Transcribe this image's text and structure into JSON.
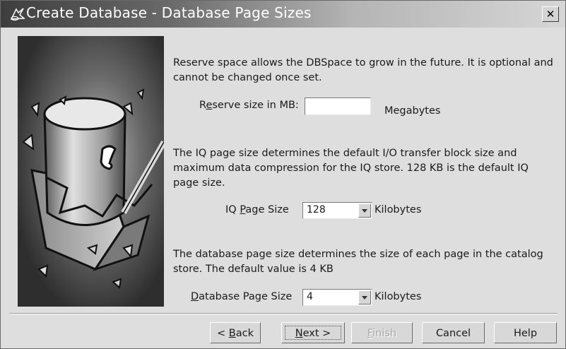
{
  "window": {
    "title": "Create Database - Database Page Sizes"
  },
  "reserve": {
    "description": "Reserve space allows the DBSpace to grow in the future.  It is optional and cannot be changed once set.",
    "label_pre": "R",
    "label_u": "e",
    "label_post": "serve size in MB:",
    "value": "",
    "unit": "Megabytes"
  },
  "iq_page": {
    "description": "The IQ page size determines the default I/O transfer block size and maximum data compression for the IQ store.  128 KB is the default IQ page size.",
    "label_pre": "IQ ",
    "label_u": "P",
    "label_post": "age Size",
    "value": "128",
    "unit": "Kilobytes"
  },
  "db_page": {
    "description": "The database page size determines the size of each page in the catalog store.  The default value is 4 KB",
    "label_pre": "",
    "label_u": "D",
    "label_post": "atabase Page Size",
    "value": "4",
    "unit": "Kilobytes"
  },
  "buttons": {
    "back_pre": "< ",
    "back_u": "B",
    "back_post": "ack",
    "next_u": "N",
    "next_post": "ext >",
    "finish_u": "F",
    "finish_post": "inish",
    "cancel": "Cancel",
    "help": "Help"
  },
  "icons": [
    "database-wizard-icon",
    "close-icon",
    "dropdown-arrow-icon",
    "database-illustration"
  ]
}
